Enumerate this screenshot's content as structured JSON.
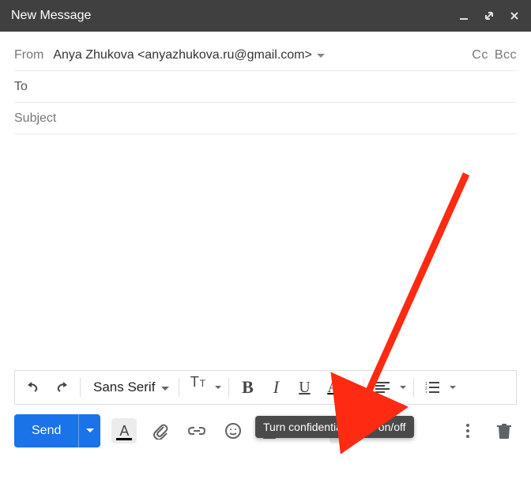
{
  "titlebar": {
    "title": "New Message"
  },
  "fields": {
    "from_label": "From",
    "from_value": "Anya Zhukova <anyazhukova.ru@gmail.com>",
    "cc_label": "Cc",
    "bcc_label": "Bcc",
    "to_label": "To",
    "subject_placeholder": "Subject"
  },
  "format": {
    "font": "Sans Serif",
    "bold": "B",
    "italic": "I",
    "underline": "U",
    "color": "A"
  },
  "actions": {
    "send": "Send",
    "formatting": "A"
  },
  "tooltip": {
    "confidential": "Turn confidential mode on/off"
  }
}
